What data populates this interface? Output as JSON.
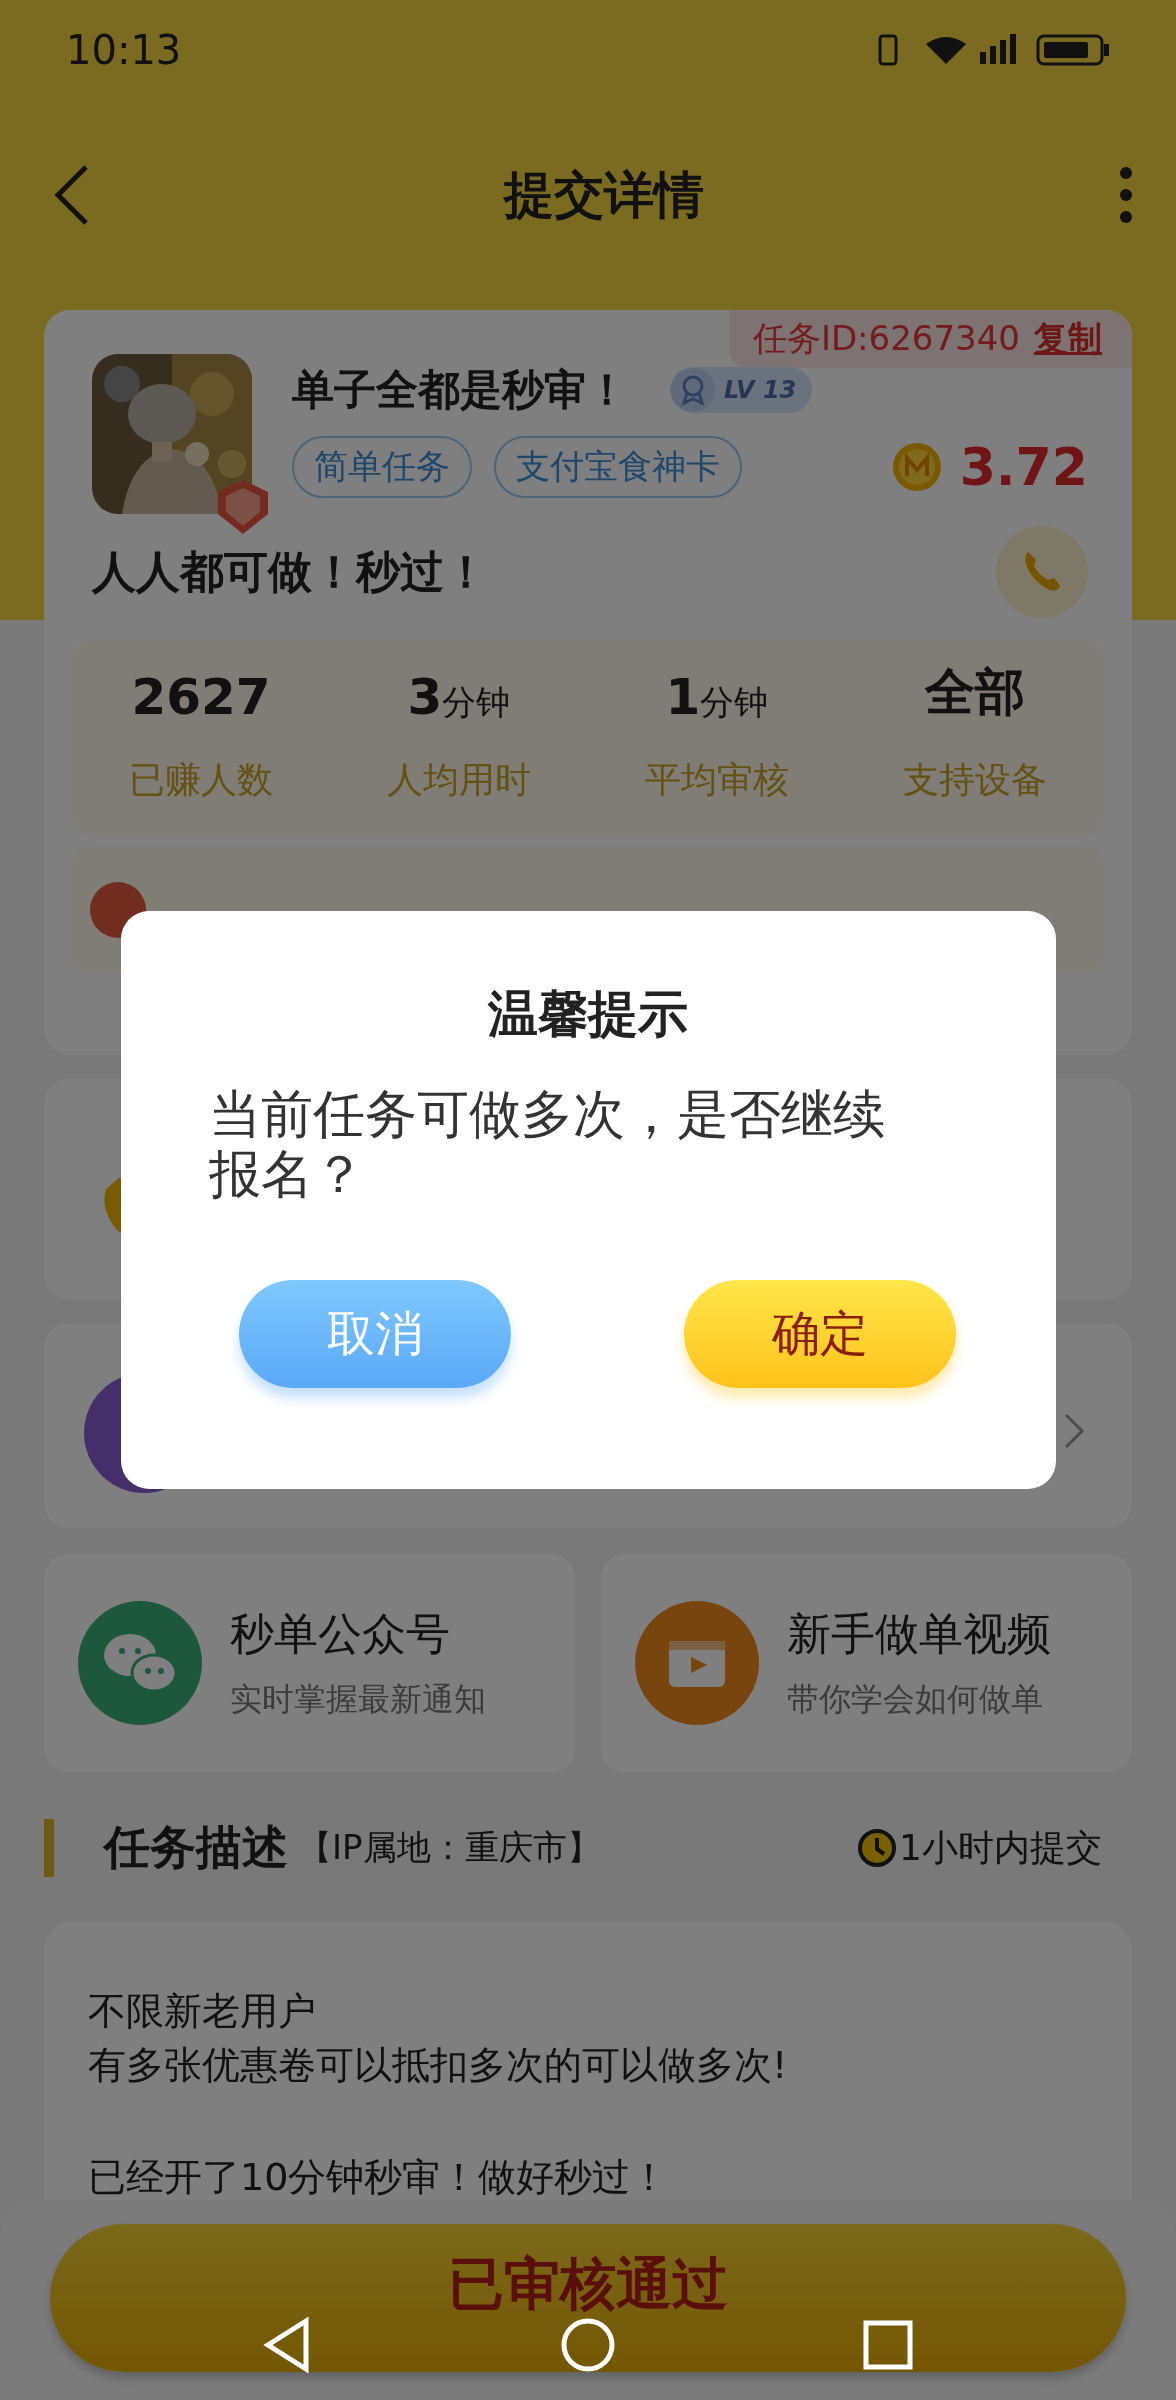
{
  "status_bar": {
    "time": "10:13"
  },
  "header": {
    "title": "提交详情"
  },
  "task": {
    "id_label": "任务ID:6267340",
    "copy": "复制",
    "name": "单子全都是秒审！",
    "level": "LV 13",
    "tags": [
      "简单任务",
      "支付宝食神卡"
    ],
    "reward": "3.72",
    "slogan": "人人都可做！秒过！",
    "stats": [
      {
        "value": "2627",
        "label": "已赚人数"
      },
      {
        "value": "3",
        "unit": "分钟",
        "label": "人均用时"
      },
      {
        "value": "1",
        "unit": "分钟",
        "label": "平均审核"
      },
      {
        "value": "全部",
        "label": "支持设备"
      }
    ]
  },
  "links": [
    {
      "kind": "wechat",
      "title": "秒单公众号",
      "subtitle": "实时掌握最新通知"
    },
    {
      "kind": "video",
      "title": "新手做单视频",
      "subtitle": "带你学会如何做单"
    }
  ],
  "description": {
    "title": "任务描述",
    "ip": "【IP属地：重庆市】",
    "deadline": "1小时内提交",
    "paragraphs": [
      [
        "不限新老用户",
        "有多张优惠卷可以抵扣多次的可以做多次!"
      ],
      [
        "已经开了10分钟秒审！做好秒过！"
      ]
    ]
  },
  "bottom_button": "已审核通过",
  "dialog": {
    "title": "温馨提示",
    "message": "当前任务可做多次，是否继续报名？",
    "buttons": [
      {
        "kind": "cancel",
        "label": "取消"
      },
      {
        "kind": "confirm",
        "label": "确定"
      }
    ]
  }
}
